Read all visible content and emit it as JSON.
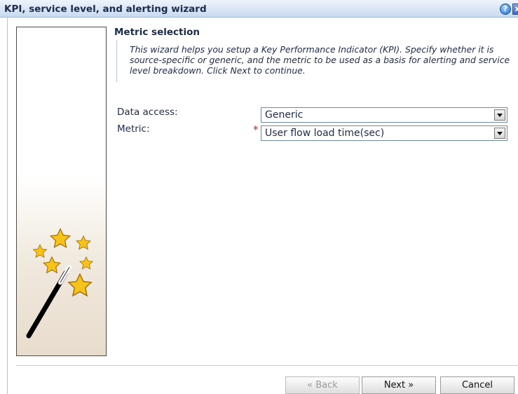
{
  "window": {
    "title": "KPI, service level, and alerting wizard",
    "help_glyph": "?",
    "close_glyph": "x"
  },
  "step": {
    "title": "Metric selection",
    "description": "This wizard helps you setup a Key Performance Indicator (KPI). Specify whether it is source-specific or generic, and the metric to be used as a basis for alerting and service level breakdown. Click Next to continue."
  },
  "form": {
    "data_access": {
      "label": "Data access:",
      "value": "Generic"
    },
    "metric": {
      "label": "Metric:",
      "value": "User flow load time(sec)",
      "required_mark": "*"
    }
  },
  "buttons": {
    "back": "« Back",
    "next": "Next »",
    "cancel": "Cancel"
  },
  "illustration": {
    "icon": "magic-wand-stars-icon"
  },
  "colors": {
    "title_text": "#1b2b4a",
    "required": "#d21f1f",
    "star_fill": "#f7c31a"
  }
}
